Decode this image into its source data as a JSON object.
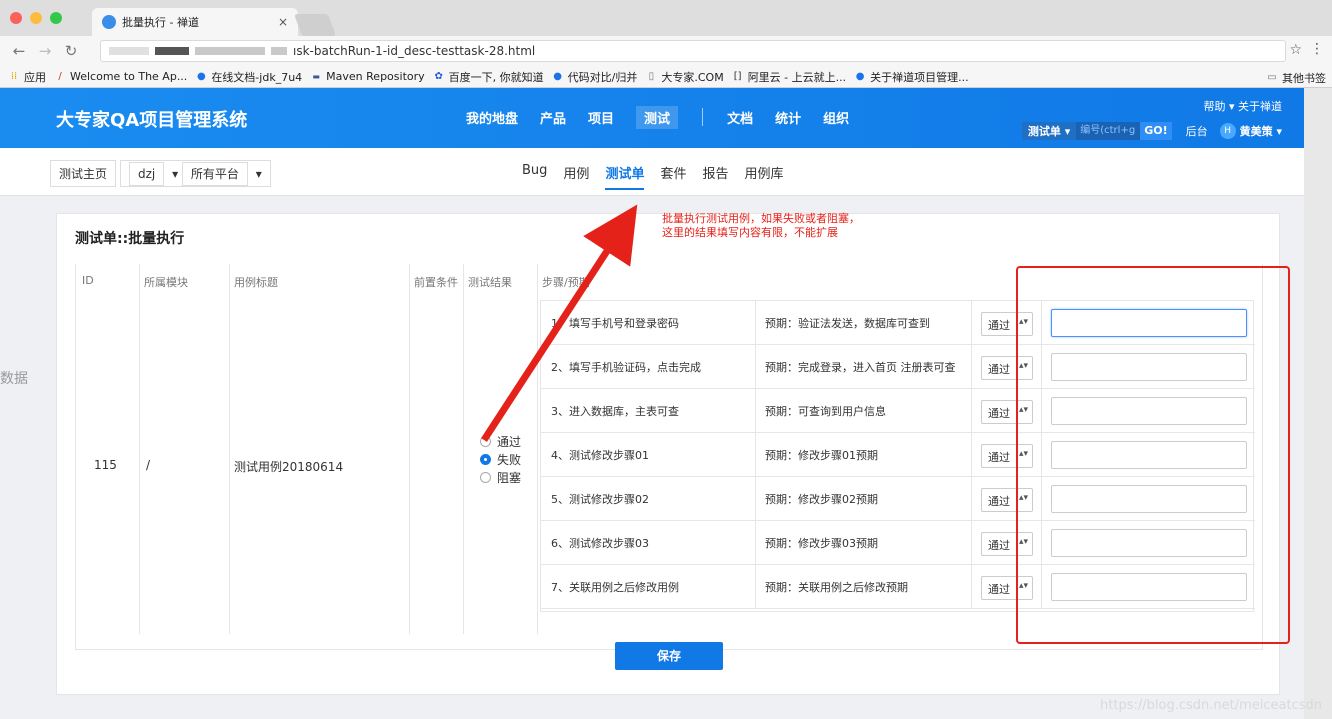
{
  "browser": {
    "tab_title": "批量执行 - 禅道",
    "tab_close": "×",
    "url_tail": "ısk-batchRun-1-id_desc-testtask-28.html",
    "bookmarks": [
      "应用",
      "Welcome to The Ap...",
      "在线文档-jdk_7u4",
      "Maven Repository",
      "百度一下, 你就知道",
      "代码对比/归并",
      "大专家.COM",
      "阿里云 - 上云就上...",
      "关于禅道项目管理..."
    ],
    "bookmark_other": "其他书签"
  },
  "header": {
    "brand": "大专家QA项目管理系统",
    "nav": [
      "我的地盘",
      "产品",
      "项目",
      "测试",
      "文档",
      "统计",
      "组织"
    ],
    "help": "帮助",
    "about": "关于禅道",
    "search_type": "测试单",
    "search_placeholder": "编号(ctrl+g",
    "go": "GO!",
    "admin": "后台",
    "avatar_letter": "H",
    "user": "黄美策"
  },
  "subnav": {
    "crumb_home": "测试主页",
    "crumb_product": "dzj",
    "crumb_platform": "所有平台",
    "tabs": [
      "Bug",
      "用例",
      "测试单",
      "套件",
      "报告",
      "用例库"
    ]
  },
  "panel": {
    "title": "测试单::批量执行",
    "headers": {
      "id": "ID",
      "module": "所属模块",
      "case_title": "用例标题",
      "precondition": "前置条件",
      "result": "测试结果",
      "steps": "步骤/预期"
    },
    "case": {
      "id": "115",
      "module": "/",
      "title": "测试用例20180614"
    },
    "result_options": [
      "通过",
      "失败",
      "阻塞"
    ],
    "result_selected": "失败",
    "steps": [
      {
        "desc": "1、填写手机号和登录密码",
        "expect": "预期：验证法发送，数据库可查到",
        "status": "通过"
      },
      {
        "desc": "2、填写手机验证码，点击完成",
        "expect": "预期：完成登录，进入首页 注册表可查",
        "status": "通过"
      },
      {
        "desc": "3、进入数据库，主表可查",
        "expect": "预期：可查询到用户信息",
        "status": "通过"
      },
      {
        "desc": "4、测试修改步骤01",
        "expect": "预期：修改步骤01预期",
        "status": "通过"
      },
      {
        "desc": "5、测试修改步骤02",
        "expect": "预期：修改步骤02预期",
        "status": "通过"
      },
      {
        "desc": "6、测试修改步骤03",
        "expect": "预期：修改步骤03预期",
        "status": "通过"
      },
      {
        "desc": "7、关联用例之后修改用例",
        "expect": "预期：关联用例之后修改预期",
        "status": "通过"
      }
    ],
    "save": "保存"
  },
  "annotation": {
    "line1": "批量执行测试用例，如果失败或者阻塞，",
    "line2": "这里的结果填写内容有限，不能扩展",
    "color": "#e5221a"
  },
  "watermark": "https://blog.csdn.net/meiceatcsdn",
  "edge_text": "数据"
}
